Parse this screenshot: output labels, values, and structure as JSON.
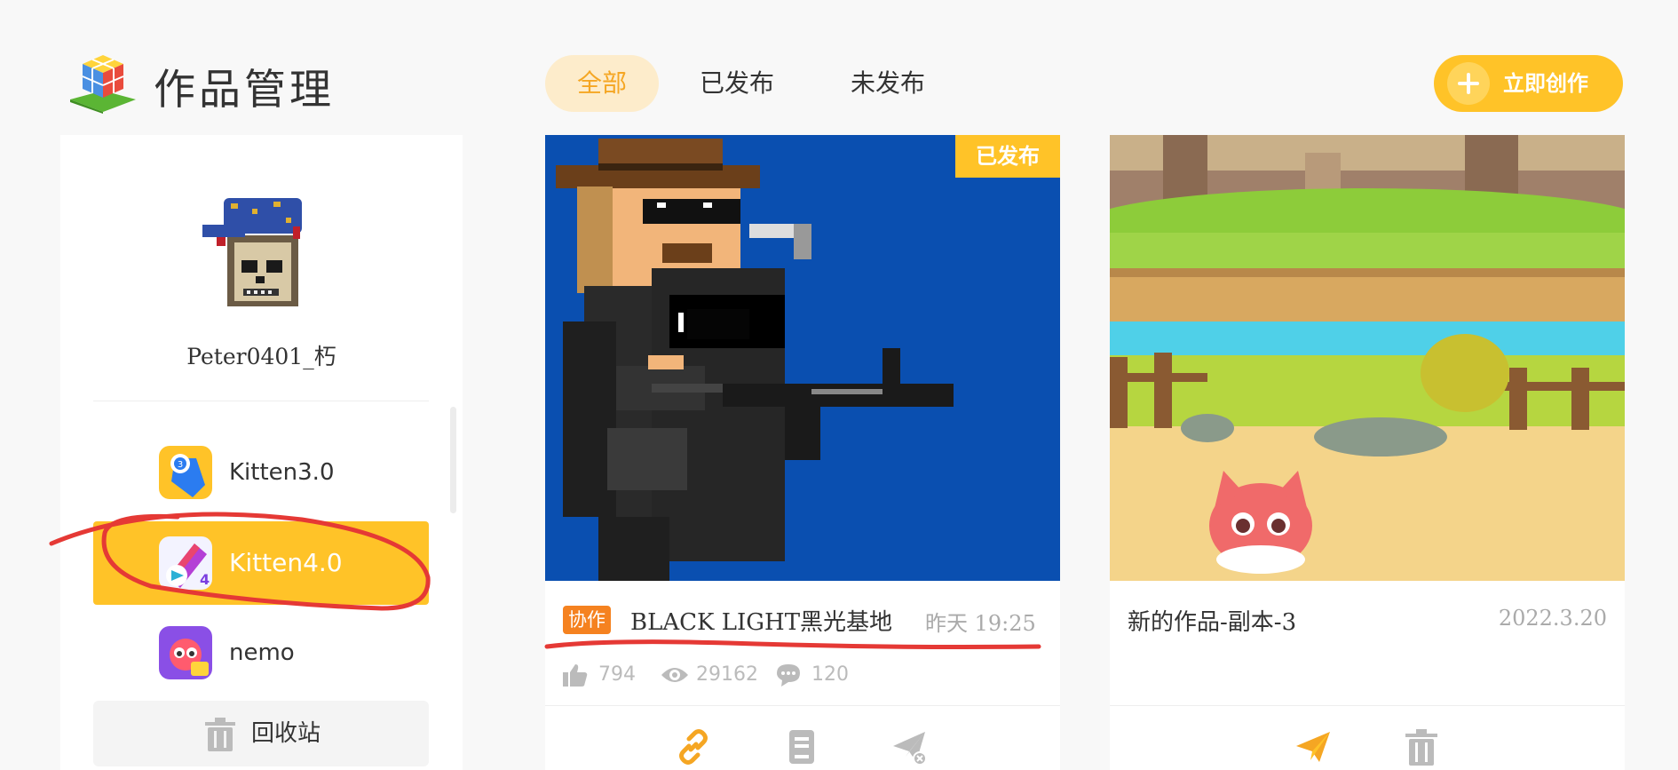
{
  "header": {
    "title": "作品管理",
    "logo_icon": "cube-logo-icon"
  },
  "tabs": [
    {
      "label": "全部",
      "active": true
    },
    {
      "label": "已发布",
      "active": false
    },
    {
      "label": "未发布",
      "active": false
    }
  ],
  "create_button": {
    "label": "立即创作",
    "icon": "plus-circle-icon"
  },
  "sidebar": {
    "username": "Peter0401_朽",
    "items": [
      {
        "label": "Kitten3.0",
        "icon": "kitten3-app-icon",
        "active": false
      },
      {
        "label": "Kitten4.0",
        "icon": "kitten4-app-icon",
        "active": true
      },
      {
        "label": "nemo",
        "icon": "nemo-app-icon",
        "active": false
      }
    ],
    "trash": {
      "label": "回收站",
      "icon": "trash-icon"
    }
  },
  "cards": [
    {
      "status": "已发布",
      "tag": "协作",
      "title": "BLACK LIGHT黑光基地",
      "time": "昨天 19:25",
      "likes": "794",
      "views": "29162",
      "comments": "120",
      "actions": [
        "link-icon",
        "document-icon",
        "unpublish-icon"
      ]
    },
    {
      "title": "新的作品-副本-3",
      "time": "2022.3.20",
      "actions": [
        "publish-icon",
        "trash-icon"
      ]
    }
  ],
  "colors": {
    "accent": "#ffc328",
    "accent_light": "#fdeccb",
    "tab_active": "#f5a623",
    "tag": "#f58220",
    "annotation": "#e53935"
  }
}
